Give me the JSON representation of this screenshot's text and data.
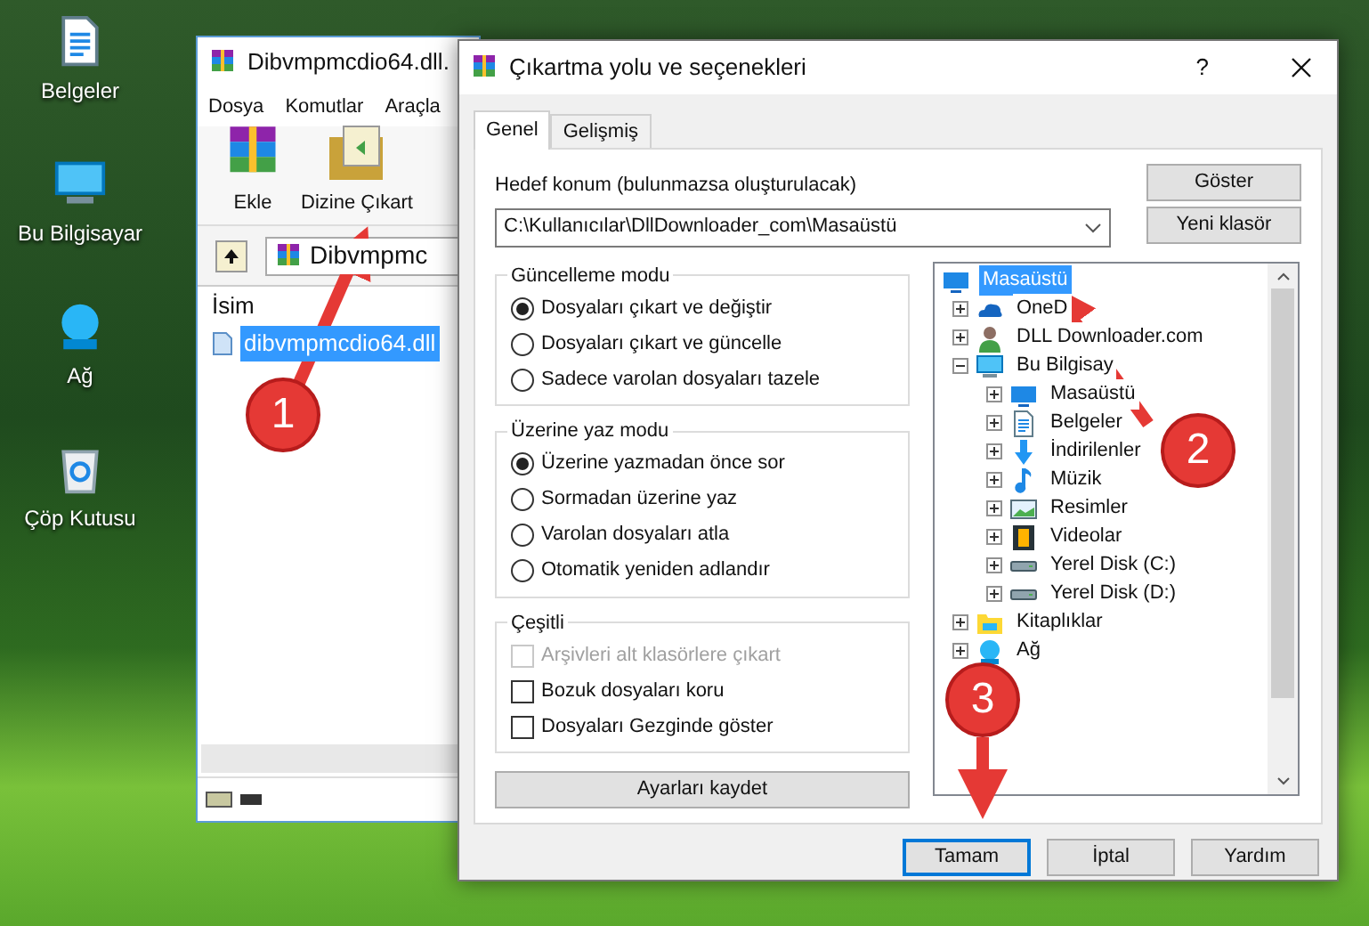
{
  "desktop": {
    "icons": [
      {
        "label": "Belgeler",
        "kind": "documents"
      },
      {
        "label": "Bu Bilgisayar",
        "kind": "computer"
      },
      {
        "label": "Ağ",
        "kind": "network"
      },
      {
        "label": "Çöp Kutusu",
        "kind": "recycle"
      }
    ]
  },
  "archive_window": {
    "title": "Dibvmpmcdio64.dll.",
    "menu": [
      "Dosya",
      "Komutlar",
      "Araçla"
    ],
    "toolbar": [
      {
        "label": "Ekle",
        "kind": "add"
      },
      {
        "label": "Dizine Çıkart",
        "kind": "extract"
      }
    ],
    "path": "Dibvmpmc",
    "column": "İsim",
    "files": [
      {
        "name": "dibvmpmcdio64.dll",
        "selected": true
      }
    ]
  },
  "dialog": {
    "title": "Çıkartma yolu ve seçenekleri",
    "help": "?",
    "tabs": [
      {
        "label": "Genel",
        "selected": true
      },
      {
        "label": "Gelişmiş",
        "selected": false
      }
    ],
    "destination_label": "Hedef konum (bulunmazsa oluşturulacak)",
    "destination_value": "C:\\Kullanıcılar\\DllDownloader_com\\Masaüstü",
    "side_buttons": [
      "Göster",
      "Yeni klasör"
    ],
    "update_mode": {
      "title": "Güncelleme modu",
      "options": [
        {
          "label": "Dosyaları çıkart ve değiştir",
          "selected": true
        },
        {
          "label": "Dosyaları çıkart ve güncelle",
          "selected": false
        },
        {
          "label": "Sadece varolan dosyaları tazele",
          "selected": false
        }
      ]
    },
    "overwrite_mode": {
      "title": "Üzerine yaz modu",
      "options": [
        {
          "label": "Üzerine yazmadan önce sor",
          "selected": true
        },
        {
          "label": "Sormadan üzerine yaz",
          "selected": false
        },
        {
          "label": "Varolan dosyaları atla",
          "selected": false
        },
        {
          "label": "Otomatik yeniden adlandır",
          "selected": false
        }
      ]
    },
    "misc": {
      "title": "Çeşitli",
      "options": [
        {
          "label": "Arşivleri alt klasörlere çıkart",
          "checked": false,
          "disabled": true
        },
        {
          "label": "Bozuk dosyaları koru",
          "checked": false,
          "disabled": false
        },
        {
          "label": "Dosyaları Gezginde göster",
          "checked": false,
          "disabled": false
        }
      ]
    },
    "save_button": "Ayarları kaydet",
    "tree": [
      {
        "label": "Masaüstü",
        "kind": "desktop",
        "selected": true,
        "children": [
          {
            "label": "OneD",
            "kind": "cloud",
            "selected": false,
            "expanded": false
          },
          {
            "label": "DLL Downloader.com",
            "kind": "user",
            "selected": false,
            "expanded": false
          },
          {
            "label": "Bu Bilgisay",
            "kind": "computer",
            "selected": false,
            "expanded": true,
            "children": [
              {
                "label": "Masaüstü",
                "kind": "desktop",
                "selected": false,
                "expanded": false
              },
              {
                "label": "Belgeler",
                "kind": "documents",
                "selected": false,
                "expanded": false
              },
              {
                "label": "İndirilenler",
                "kind": "download",
                "selected": false,
                "expanded": false
              },
              {
                "label": "Müzik",
                "kind": "music",
                "selected": false,
                "expanded": false
              },
              {
                "label": "Resimler",
                "kind": "pictures",
                "selected": false,
                "expanded": false
              },
              {
                "label": "Videolar",
                "kind": "videos",
                "selected": false,
                "expanded": false
              },
              {
                "label": "Yerel Disk (C:)",
                "kind": "drive",
                "selected": false,
                "expanded": false
              },
              {
                "label": "Yerel Disk (D:)",
                "kind": "drive",
                "selected": false,
                "expanded": false
              }
            ]
          },
          {
            "label": "Kitaplıklar",
            "kind": "library",
            "selected": false,
            "expanded": false
          },
          {
            "label": "Ağ",
            "kind": "network",
            "selected": false,
            "expanded": false
          }
        ]
      }
    ],
    "buttons": [
      {
        "label": "Tamam",
        "focused": true
      },
      {
        "label": "İptal",
        "focused": false
      },
      {
        "label": "Yardım",
        "focused": false
      }
    ]
  },
  "callouts": [
    "1",
    "2",
    "3"
  ]
}
